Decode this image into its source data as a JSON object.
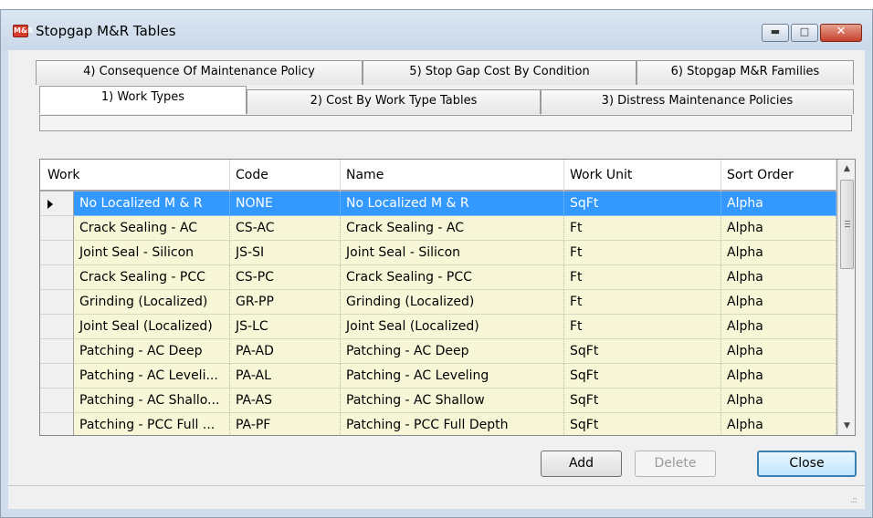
{
  "window": {
    "title": "Stopgap M&R Tables",
    "icon_text": "M&R",
    "minimize_symbol": "▬",
    "maximize_symbol": "□",
    "close_symbol": "✕"
  },
  "tabs": {
    "row_back": [
      {
        "label": "4) Consequence Of Maintenance Policy"
      },
      {
        "label": "5) Stop Gap Cost By Condition"
      },
      {
        "label": "6) Stopgap M&R Families"
      }
    ],
    "row_front": [
      {
        "label": "1) Work Types"
      },
      {
        "label": "2) Cost By Work Type Tables"
      },
      {
        "label": "3) Distress Maintenance Policies"
      }
    ],
    "active": "1) Work Types"
  },
  "grid": {
    "columns": [
      "Work",
      "Code",
      "Name",
      "Work Unit",
      "Sort Order"
    ],
    "rows": [
      {
        "work": "No Localized M & R",
        "code": "NONE",
        "name": "No Localized M & R",
        "unit": "SqFt",
        "sort": "Alpha",
        "selected": true
      },
      {
        "work": "Crack Sealing - AC",
        "code": "CS-AC",
        "name": "Crack Sealing - AC",
        "unit": "Ft",
        "sort": "Alpha"
      },
      {
        "work": "Joint Seal - Silicon",
        "code": "JS-SI",
        "name": "Joint Seal - Silicon",
        "unit": "Ft",
        "sort": "Alpha"
      },
      {
        "work": "Crack Sealing - PCC",
        "code": "CS-PC",
        "name": "Crack Sealing - PCC",
        "unit": "Ft",
        "sort": "Alpha"
      },
      {
        "work": "Grinding (Localized)",
        "code": "GR-PP",
        "name": "Grinding (Localized)",
        "unit": "Ft",
        "sort": "Alpha"
      },
      {
        "work": "Joint Seal (Localized)",
        "code": "JS-LC",
        "name": "Joint Seal (Localized)",
        "unit": "Ft",
        "sort": "Alpha"
      },
      {
        "work": "Patching - AC Deep",
        "code": "PA-AD",
        "name": "Patching - AC Deep",
        "unit": "SqFt",
        "sort": "Alpha"
      },
      {
        "work": "Patching - AC Leveli...",
        "code": "PA-AL",
        "name": "Patching - AC Leveling",
        "unit": "SqFt",
        "sort": "Alpha"
      },
      {
        "work": "Patching - AC Shallo...",
        "code": "PA-AS",
        "name": "Patching - AC Shallow",
        "unit": "SqFt",
        "sort": "Alpha"
      },
      {
        "work": "Patching - PCC Full ...",
        "code": "PA-PF",
        "name": "Patching - PCC Full Depth",
        "unit": "SqFt",
        "sort": "Alpha"
      }
    ]
  },
  "buttons": {
    "add": "Add",
    "delete": "Delete",
    "close": "Close"
  },
  "scrollbar": {
    "up_symbol": "▲",
    "down_symbol": "▼"
  },
  "statusbar": {
    "grip_symbol": ".::"
  },
  "colors": {
    "selected_row": "#3399ff",
    "row_background": "#f7f7d8",
    "frame": "#cfdcea"
  }
}
